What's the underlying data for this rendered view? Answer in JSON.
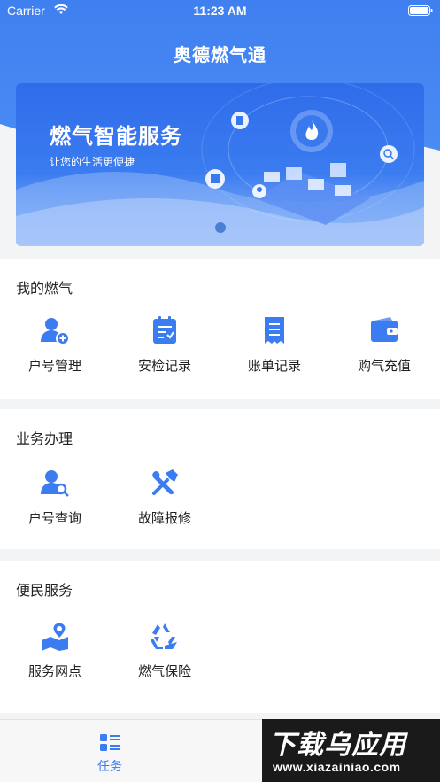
{
  "status_bar": {
    "carrier": "Carrier",
    "time": "11:23 AM"
  },
  "app": {
    "title": "奥德燃气通"
  },
  "banner": {
    "title": "燃气智能服务",
    "subtitle": "让您的生活更便捷"
  },
  "sections": {
    "my_gas": {
      "title": "我的燃气",
      "items": [
        {
          "label": "户号管理",
          "icon": "user-add-icon"
        },
        {
          "label": "安检记录",
          "icon": "clipboard-check-icon"
        },
        {
          "label": "账单记录",
          "icon": "bill-icon"
        },
        {
          "label": "购气充值",
          "icon": "wallet-icon"
        }
      ]
    },
    "business": {
      "title": "业务办理",
      "items": [
        {
          "label": "户号查询",
          "icon": "user-search-icon"
        },
        {
          "label": "故障报修",
          "icon": "repair-tools-icon"
        }
      ]
    },
    "convenience": {
      "title": "便民服务",
      "items": [
        {
          "label": "服务网点",
          "icon": "map-pin-icon"
        },
        {
          "label": "燃气保险",
          "icon": "recycle-icon"
        }
      ]
    }
  },
  "tabbar": {
    "tabs": [
      {
        "label": "任务",
        "icon": "task-list-icon",
        "active": true
      }
    ]
  },
  "watermark": {
    "big": "下载乌应用",
    "small": "www.xiazainiao.com"
  },
  "colors": {
    "primary": "#3b7cf0",
    "header": "#4a8cf5",
    "background": "#f3f4f6"
  }
}
